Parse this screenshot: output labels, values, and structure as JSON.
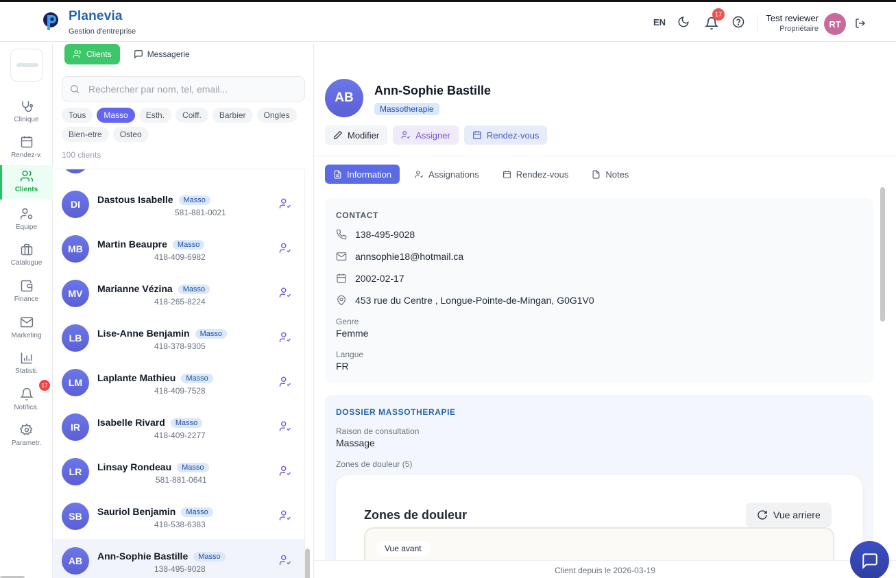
{
  "header": {
    "brand_name": "Planevia",
    "brand_sub": "Gestion d'entreprise",
    "lang": "EN",
    "notif_count": "17",
    "user_name": "Test reviewer",
    "user_role": "Propriétaire",
    "user_initials": "RT"
  },
  "nav": {
    "items": [
      {
        "label": "Clinique",
        "icon": "stethoscope-icon"
      },
      {
        "label": "Rendez-v.",
        "icon": "calendar-icon"
      },
      {
        "label": "Clients",
        "icon": "users-icon"
      },
      {
        "label": "Equipe",
        "icon": "team-gear-icon"
      },
      {
        "label": "Catalogue",
        "icon": "briefcase-icon"
      },
      {
        "label": "Finance",
        "icon": "wallet-icon"
      },
      {
        "label": "Marketing",
        "icon": "mail-icon"
      },
      {
        "label": "Statisti.",
        "icon": "bar-chart-icon"
      },
      {
        "label": "Notifica.",
        "icon": "bell-icon"
      },
      {
        "label": "Parametr.",
        "icon": "gear-icon"
      }
    ],
    "notif_badge": "17"
  },
  "mid": {
    "tabs": [
      "Clients",
      "Messagerie"
    ],
    "search_placeholder": "Rechercher par nom, tel, email...",
    "filters": [
      "Tous",
      "Masso",
      "Esth.",
      "Coiff.",
      "Barbier",
      "Ongles",
      "Bien-etre",
      "Osteo"
    ],
    "count": "100 clients",
    "clients": [
      {
        "initials": "DI",
        "name": "Dastous Isabelle",
        "tag": "Masso",
        "phone": "581-881-0021"
      },
      {
        "initials": "MB",
        "name": "Martin Beaupre",
        "tag": "Masso",
        "phone": "418-409-6982"
      },
      {
        "initials": "MV",
        "name": "Marianne Vézina",
        "tag": "Masso",
        "phone": "418-265-8224"
      },
      {
        "initials": "LB",
        "name": "Lise-Anne Benjamin",
        "tag": "Masso",
        "phone": "418-378-9305"
      },
      {
        "initials": "LM",
        "name": "Laplante Mathieu",
        "tag": "Masso",
        "phone": "418-409-7528"
      },
      {
        "initials": "IR",
        "name": "Isabelle Rivard",
        "tag": "Masso",
        "phone": "418-409-2277"
      },
      {
        "initials": "LR",
        "name": "Linsay Rondeau",
        "tag": "Masso",
        "phone": "581-881-0641"
      },
      {
        "initials": "SB",
        "name": "Sauriol Benjamin",
        "tag": "Masso",
        "phone": "418-538-6383"
      },
      {
        "initials": "AB",
        "name": "Ann-Sophie Bastille",
        "tag": "Masso",
        "phone": "138-495-9028"
      }
    ]
  },
  "detail": {
    "initials": "AB",
    "name": "Ann-Sophie Bastille",
    "tag": "Massotherapie",
    "actions": [
      "Modifier",
      "Assigner",
      "Rendez-vous"
    ],
    "tabs": [
      "Information",
      "Assignations",
      "Rendez-vous",
      "Notes"
    ],
    "contact": {
      "title": "CONTACT",
      "phone": "138-495-9028",
      "email": "annsophie18@hotmail.ca",
      "birthdate": "2002-02-17",
      "address": "453 rue du Centre , Longue-Pointe-de-Mingan, G0G1V0",
      "genre_label": "Genre",
      "genre": "Femme",
      "langue_label": "Langue",
      "langue": "FR"
    },
    "dossier": {
      "title": "DOSSIER MASSOTHERAPIE",
      "reason_label": "Raison de consultation",
      "reason": "Massage",
      "zones_label": "Zones de douleur (5)",
      "zones_title": "Zones de douleur",
      "rear_view_btn": "Vue arriere",
      "front_view": "Vue avant"
    },
    "footer": "Client depuis le 2026-03-19"
  }
}
